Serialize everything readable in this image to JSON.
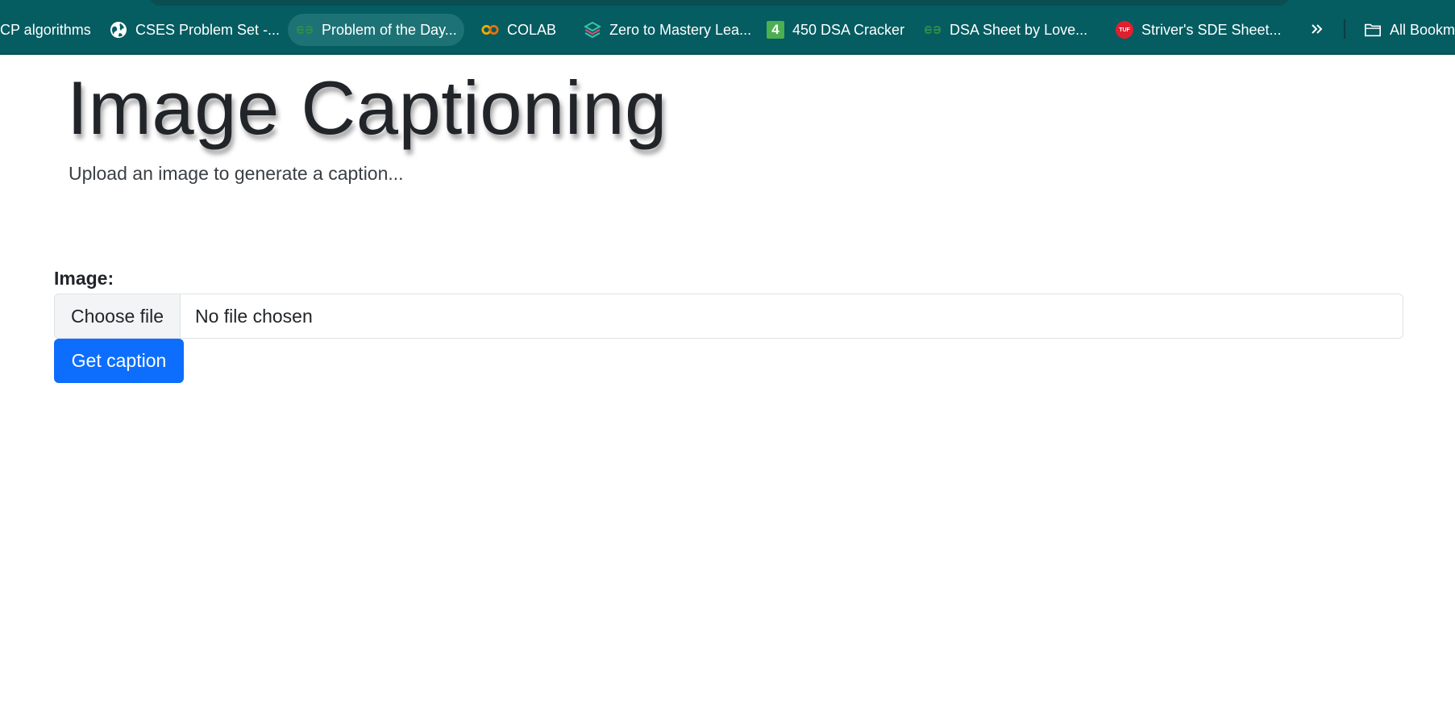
{
  "bookmarks_bar": {
    "items": [
      {
        "label": "CP algorithms",
        "icon": "none"
      },
      {
        "label": "CSES Problem Set -...",
        "icon": "globe-icon"
      },
      {
        "label": "Problem of the Day...",
        "icon": "geeksforgeeks-icon"
      },
      {
        "label": "COLAB",
        "icon": "colab-icon"
      },
      {
        "label": "Zero to Mastery Lea...",
        "icon": "zero-to-mastery-icon"
      },
      {
        "label": "450 DSA Cracker",
        "icon": "four-badge-icon",
        "icon_text": "4"
      },
      {
        "label": "DSA Sheet by Love...",
        "icon": "geeksforgeeks-icon"
      },
      {
        "label": "Striver's SDE Sheet...",
        "icon": "tuf-icon",
        "icon_text": "TUF"
      }
    ],
    "more_icon": "chevron-double-right-icon",
    "all_bookmarks_label": "All Bookm",
    "colors": {
      "bar_background": "#055c61",
      "gfg_green": "#2f8d46",
      "colab_orange": "#f9ab00",
      "four_badge_green": "#4caf50",
      "tuf_red": "#e0202f"
    }
  },
  "page": {
    "title": "Image Captioning",
    "subtitle": "Upload an image to generate a caption...",
    "form": {
      "image_label": "Image:",
      "choose_file_label": "Choose file",
      "file_status": "No file chosen",
      "submit_label": "Get caption"
    },
    "colors": {
      "primary_button": "#0d6efd",
      "text": "#212529"
    }
  }
}
